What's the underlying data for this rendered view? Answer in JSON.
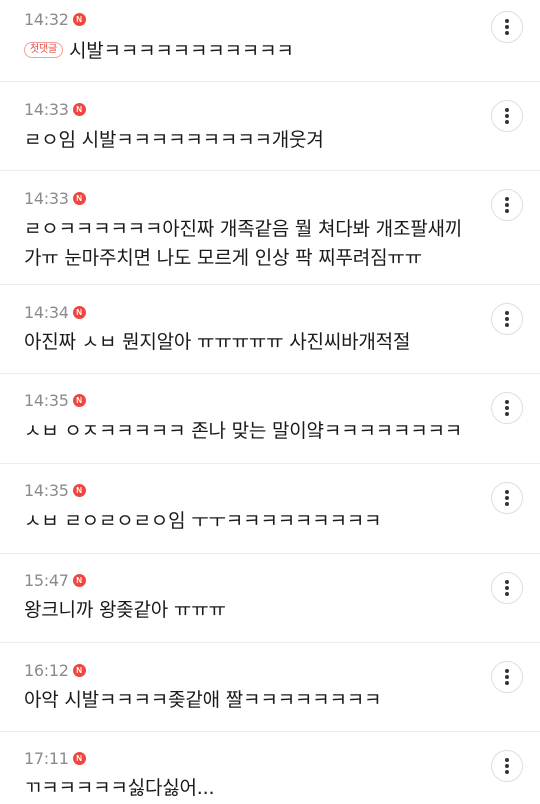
{
  "comments": [
    {
      "time": "14:32",
      "badge": "N",
      "first_label": "첫댓글",
      "text": "시발ㅋㅋㅋㅋㅋㅋㅋㅋㅋㅋㅋ"
    },
    {
      "time": "14:33",
      "badge": "N",
      "text": "ㄹㅇ임 시발ㅋㅋㅋㅋㅋㅋㅋㅋㅋ개웃겨"
    },
    {
      "time": "14:33",
      "badge": "N",
      "text": "ㄹㅇㅋㅋㅋㅋㅋㅋ아진짜 개족같음 뭘 쳐다봐 개조팔새끼 가ㅠ 눈마주치면 나도 모르게 인상 팍 찌푸려짐ㅠㅠ"
    },
    {
      "time": "14:34",
      "badge": "N",
      "text": "아진짜 ㅅㅂ 뭔지알아 ㅠㅠㅠㅠㅠ 사진씨바개적절"
    },
    {
      "time": "14:35",
      "badge": "N",
      "text": "ㅅㅂ ㅇㅈㅋㅋㅋㅋㅋ 존나 맞는 말이얔ㅋㅋㅋㅋㅋㅋㅋㅋ"
    },
    {
      "time": "14:35",
      "badge": "N",
      "text": "ㅅㅂ ㄹㅇㄹㅇㄹㅇ임 ㅜㅜㅋㅋㅋㅋㅋㅋㅋㅋㅋ"
    },
    {
      "time": "15:47",
      "badge": "N",
      "text": "왕크니까 왕좆같아 ㅠㅠㅠ"
    },
    {
      "time": "16:12",
      "badge": "N",
      "text": "아악 시발ㅋㅋㅋㅋ좆같애 짤ㅋㅋㅋㅋㅋㅋㅋㅋ"
    },
    {
      "time": "17:11",
      "badge": "N",
      "text": "ㄲㅋㅋㅋㅋㅋ싫다싫어..."
    }
  ]
}
